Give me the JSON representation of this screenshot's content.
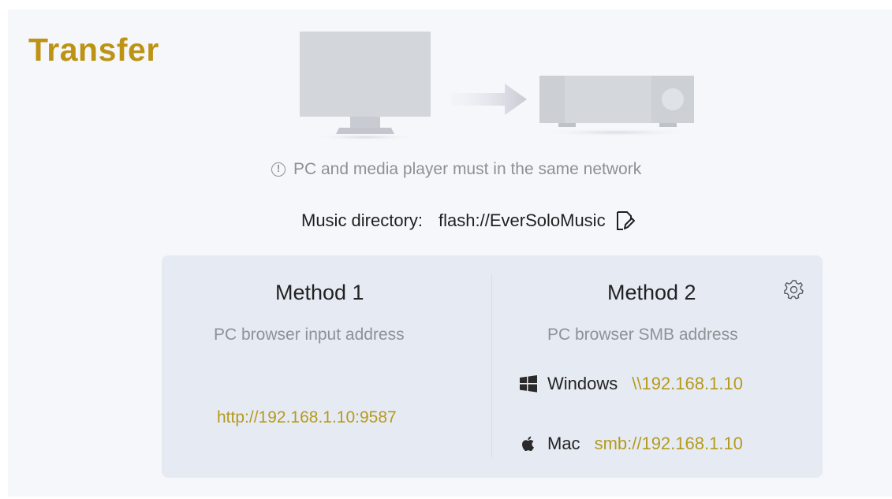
{
  "page": {
    "title": "Transfer"
  },
  "notice": {
    "text": "PC and media player must in the same network",
    "icon": "info-icon"
  },
  "music_directory": {
    "label": "Music directory:",
    "value": "flash://EverSoloMusic",
    "edit_icon": "edit-icon"
  },
  "method1": {
    "title": "Method 1",
    "subtitle": "PC browser input address",
    "address": "http://192.168.1.10:9587"
  },
  "method2": {
    "title": "Method 2",
    "subtitle": "PC browser SMB address",
    "settings_icon": "gear-icon",
    "windows": {
      "label": "Windows",
      "address": "\\\\192.168.1.10",
      "icon": "windows-icon"
    },
    "mac": {
      "label": "Mac",
      "address": "smb://192.168.1.10",
      "icon": "apple-icon"
    }
  },
  "colors": {
    "accent": "#bd9314",
    "link": "#b59a1c",
    "panel": "#e6ebf3",
    "background": "#f5f7fb"
  }
}
